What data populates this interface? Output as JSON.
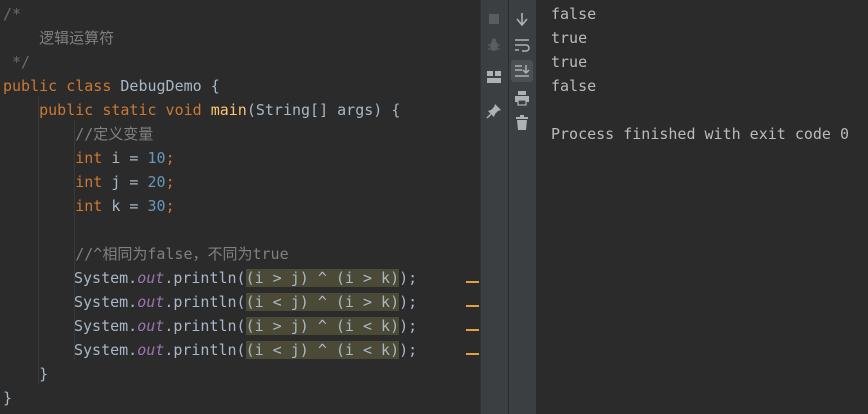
{
  "editor": {
    "lines": [
      {
        "fold": "/*",
        "text": ""
      },
      {
        "fold": "",
        "text": "    逻辑运算符"
      },
      {
        "fold": " */",
        "text": ""
      },
      {
        "kw1": "public class ",
        "name": "DebugDemo",
        "rest": " {"
      },
      {
        "indent": "    ",
        "kw1": "public static void ",
        "fn": "main",
        "rest": "(String[] args) {"
      },
      {
        "indent": "        ",
        "comment": "//定义变量"
      },
      {
        "indent": "        ",
        "kw1": "int ",
        "name": "i = ",
        "num": "10",
        "semi": ";"
      },
      {
        "indent": "        ",
        "kw1": "int ",
        "name": "j = ",
        "num": "20",
        "semi": ";"
      },
      {
        "indent": "        ",
        "kw1": "int ",
        "name": "k = ",
        "num": "30",
        "semi": ";"
      },
      {
        "indent": "",
        "text": ""
      },
      {
        "indent": "        ",
        "comment": "//^相同为false，不同为true"
      },
      {
        "call": "System.",
        "field": "out",
        "method": ".println(",
        "expr": "(i > j) ^ (i > k)",
        "close": ");"
      },
      {
        "call": "System.",
        "field": "out",
        "method": ".println(",
        "expr": "(i < j) ^ (i > k)",
        "close": ");"
      },
      {
        "call": "System.",
        "field": "out",
        "method": ".println(",
        "expr": "(i > j) ^ (i < k)",
        "close": ");"
      },
      {
        "call": "System.",
        "field": "out",
        "method": ".println(",
        "expr": "(i < j) ^ (i < k)",
        "close": ");"
      },
      {
        "indent": "    ",
        "brace": "}"
      },
      {
        "indent": "",
        "brace": "}"
      }
    ]
  },
  "toolbar_a": {
    "icons": [
      "stop-icon",
      "bug-icon",
      "layout-icon",
      "pin-icon"
    ]
  },
  "toolbar_b": {
    "icons": [
      "scroll-down-icon",
      "soft-wrap-icon",
      "scroll-to-end-icon",
      "print-icon",
      "trash-icon"
    ]
  },
  "console": {
    "output": [
      "false",
      "true",
      "true",
      "false"
    ],
    "exit_message": "Process finished with exit code 0"
  },
  "colors": {
    "background": "#2b2b2b",
    "keyword": "#cc7832",
    "number": "#6897bb",
    "comment": "#808080",
    "method_decl": "#ffc66d",
    "static_field": "#9876aa",
    "highlight": "#4a4a36",
    "change_marker": "#e0a23b"
  }
}
